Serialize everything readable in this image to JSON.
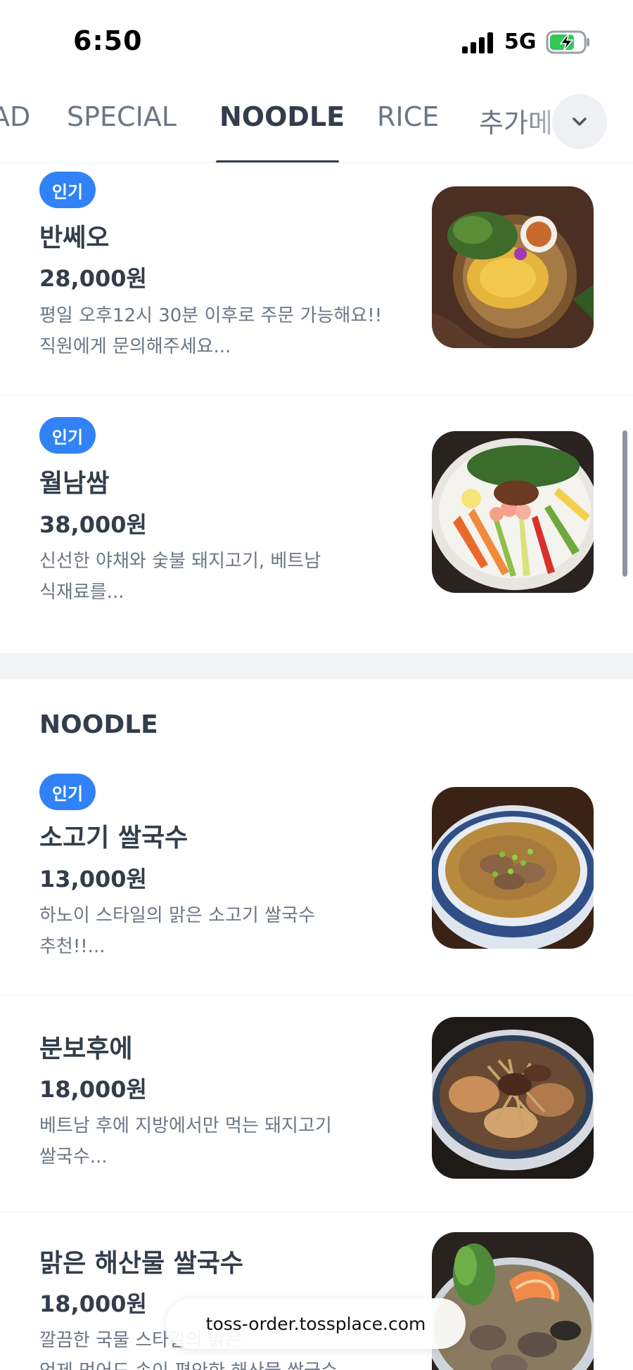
{
  "status_bar": {
    "time": "6:50",
    "network": "5G",
    "battery_state": "charging"
  },
  "tabs": [
    {
      "label": "AD",
      "active": false
    },
    {
      "label": "SPECIAL",
      "active": false
    },
    {
      "label": "NOODLE",
      "active": true
    },
    {
      "label": "RICE",
      "active": false
    },
    {
      "label": "추가메",
      "active": false
    }
  ],
  "badge_label": "인기",
  "items_top": [
    {
      "name": "반쎄오",
      "price": "28,000원",
      "desc_line1": "평일 오후12시 30분 이후로 주문 가능해요!!",
      "desc_line2": "직원에게 문의해주세요...",
      "popular": true,
      "photo": "banh-xeo-photo"
    },
    {
      "name": "월남쌈",
      "price": "38,000원",
      "desc_line1": "신선한 야채와 숯불 돼지고기, 베트남",
      "desc_line2": "식재료를...",
      "popular": true,
      "photo": "spring-roll-platter-photo"
    }
  ],
  "section": {
    "title": "NOODLE"
  },
  "items_noodle": [
    {
      "name": "소고기 쌀국수",
      "price": "13,000원",
      "desc_line1": "하노이 스타일의 맑은 소고기 쌀국수",
      "desc_line2": "추천!!...",
      "popular": true,
      "photo": "beef-pho-photo"
    },
    {
      "name": "분보후에",
      "price": "18,000원",
      "desc_line1": "베트남 후에 지방에서만 먹는 돼지고기",
      "desc_line2": "쌀국수...",
      "popular": false,
      "photo": "bun-bo-hue-photo"
    },
    {
      "name": "맑은 해산물 쌀국수",
      "price": "18,000원",
      "desc_line1": "깔끔한 국물 스타일의 맑은",
      "desc_line2": "언제 먹어도 속이 편안한 해산물 쌀국수",
      "popular": false,
      "photo": "seafood-pho-photo"
    }
  ],
  "url_bar": {
    "domain": "toss-order.tossplace.com"
  },
  "colors": {
    "accent": "#3182f6",
    "text_primary": "#333d4b",
    "text_secondary": "#6b7684",
    "section_gap": "#f2f4f6"
  }
}
